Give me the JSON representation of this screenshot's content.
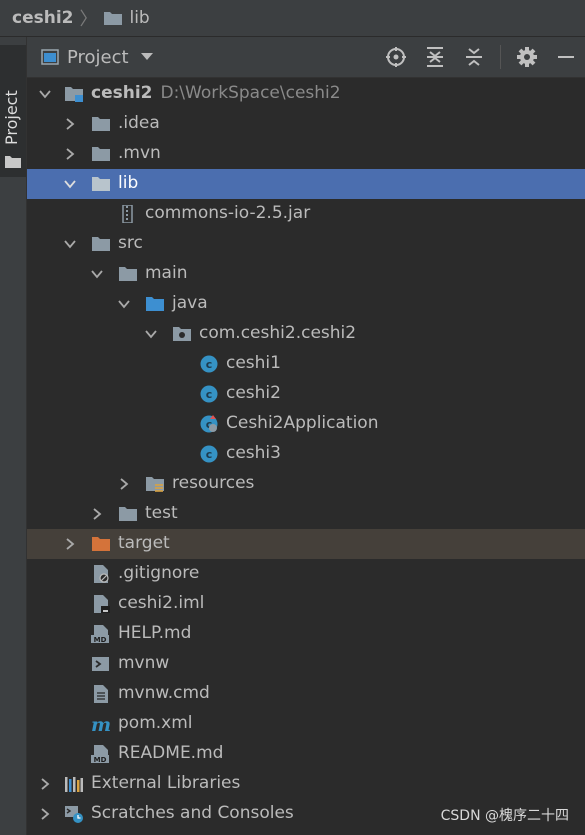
{
  "navbar": {
    "project": "ceshi2",
    "folder": "lib"
  },
  "toolstrip": {
    "tab_label": "Project"
  },
  "panel": {
    "title": "Project"
  },
  "tree": {
    "root": {
      "name": "ceshi2",
      "path": "D:\\WorkSpace\\ceshi2"
    },
    "idea": ".idea",
    "mvn": ".mvn",
    "lib": "lib",
    "commons_jar": "commons-io-2.5.jar",
    "src": "src",
    "main": "main",
    "java": "java",
    "package": "com.ceshi2.ceshi2",
    "ceshi1": "ceshi1",
    "ceshi2": "ceshi2",
    "app": "Ceshi2Application",
    "ceshi3": "ceshi3",
    "resources": "resources",
    "test": "test",
    "target": "target",
    "gitignore": ".gitignore",
    "iml": "ceshi2.iml",
    "help": "HELP.md",
    "mvnw": "mvnw",
    "mvnw_cmd": "mvnw.cmd",
    "pom": "pom.xml",
    "readme": "README.md",
    "external_libraries": "External Libraries",
    "scratches": "Scratches and Consoles"
  },
  "watermark": "CSDN @槐序二十四",
  "colors": {
    "selection": "#4b6eaf",
    "excluded_row": "#45403a",
    "folder": "#8c9aa5",
    "source_folder": "#3d8fd1",
    "target_folder": "#d4733a",
    "class_icon": "#3592c4"
  }
}
